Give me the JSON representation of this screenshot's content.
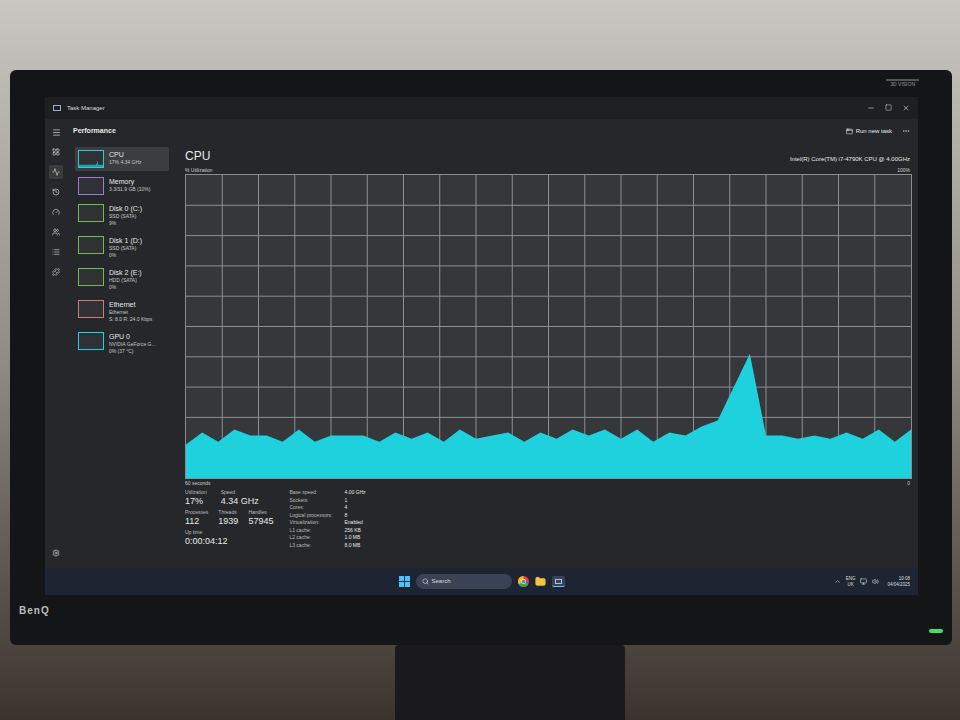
{
  "monitor": {
    "brand": "BenQ",
    "sticker": "3D VISION",
    "power_on": true
  },
  "window": {
    "title": "Task Manager",
    "page": "Performance",
    "run_task": "Run new task"
  },
  "sidebar": {
    "items": [
      {
        "name": "CPU",
        "lines": [
          "17% 4.34 GHz"
        ],
        "selected": true,
        "color": "#1fd1dc"
      },
      {
        "name": "Memory",
        "lines": [
          "3.3/31.9 GB (10%)"
        ],
        "selected": false,
        "color": "#9b7bd4"
      },
      {
        "name": "Disk 0 (C:)",
        "lines": [
          "SSD (SATA)",
          "9%"
        ],
        "selected": false,
        "color": "#6cc04a"
      },
      {
        "name": "Disk 1 (D:)",
        "lines": [
          "SSD (SATA)",
          "0%"
        ],
        "selected": false,
        "color": "#6cc04a"
      },
      {
        "name": "Disk 2 (E:)",
        "lines": [
          "HDD (SATA)",
          "0%"
        ],
        "selected": false,
        "color": "#6cc04a"
      },
      {
        "name": "Ethernet",
        "lines": [
          "Ethernet",
          "S: 8.0 R: 24.0 Kbps"
        ],
        "selected": false,
        "color": "#c77b7b"
      },
      {
        "name": "GPU 0",
        "lines": [
          "NVIDIA GeForce G…",
          "0% (37 °C)"
        ],
        "selected": false,
        "color": "#1fd1dc"
      }
    ]
  },
  "main": {
    "title": "CPU",
    "model": "Intel(R) Core(TM) i7-4790K CPU @ 4.00GHz",
    "y_label": "% Utilization",
    "y_max": "100%",
    "x_label": "60 seconds",
    "x_min": "0",
    "chart": {
      "series": [
        {
          "name": "CPU",
          "color": "#1fd1dc",
          "values": [
            11,
            15,
            12,
            16,
            14,
            14,
            12,
            16,
            12,
            14,
            14,
            14,
            12,
            15,
            13,
            15,
            12,
            16,
            13,
            14,
            15,
            12,
            15,
            13,
            16,
            14,
            16,
            13,
            16,
            12,
            15,
            14,
            17,
            19,
            30,
            41,
            14,
            14,
            13,
            14,
            13,
            15,
            13,
            16,
            12,
            16
          ]
        }
      ]
    }
  },
  "stats": {
    "top": [
      {
        "label": "Utilization",
        "value": "17%"
      },
      {
        "label": "Speed",
        "value": "4.34 GHz"
      }
    ],
    "middle": [
      {
        "label": "Processes",
        "value": "112"
      },
      {
        "label": "Threads",
        "value": "1939"
      },
      {
        "label": "Handles",
        "value": "57945"
      }
    ],
    "uptime": {
      "label": "Up time",
      "value": "0:00:04:12"
    }
  },
  "specs": [
    {
      "label": "Base speed:",
      "value": "4.00 GHz"
    },
    {
      "label": "Sockets:",
      "value": "1"
    },
    {
      "label": "Cores:",
      "value": "4"
    },
    {
      "label": "Logical processors:",
      "value": "8"
    },
    {
      "label": "Virtualization:",
      "value": "Enabled"
    },
    {
      "label": "L1 cache:",
      "value": "256 KB"
    },
    {
      "label": "L2 cache:",
      "value": "1.0 MB"
    },
    {
      "label": "L3 cache:",
      "value": "8.0 MB"
    }
  ],
  "taskbar": {
    "search": "Search",
    "language": [
      "ENG",
      "UK"
    ],
    "time": "10:08",
    "date": "04/04/2025"
  }
}
